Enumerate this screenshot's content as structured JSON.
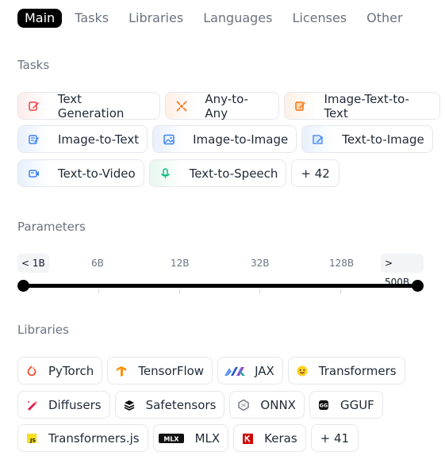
{
  "tabs": [
    "Main",
    "Tasks",
    "Libraries",
    "Languages",
    "Licenses",
    "Other"
  ],
  "tasks": {
    "title": "Tasks",
    "items": [
      {
        "label": "Text Generation",
        "icon": "text-generation-icon",
        "color": "#ef4444"
      },
      {
        "label": "Any-to-Any",
        "icon": "any-to-any-icon",
        "color": "#f97316"
      },
      {
        "label": "Image-Text-to-Text",
        "icon": "image-text-to-text-icon",
        "color": "#f97316"
      },
      {
        "label": "Image-to-Text",
        "icon": "image-to-text-icon",
        "color": "#3b82f6"
      },
      {
        "label": "Image-to-Image",
        "icon": "image-to-image-icon",
        "color": "#3b82f6"
      },
      {
        "label": "Text-to-Image",
        "icon": "text-to-image-icon",
        "color": "#3b82f6"
      },
      {
        "label": "Text-to-Video",
        "icon": "text-to-video-icon",
        "color": "#3b82f6"
      },
      {
        "label": "Text-to-Speech",
        "icon": "text-to-speech-icon",
        "color": "#10b981"
      }
    ],
    "more": "+ 42"
  },
  "parameters": {
    "title": "Parameters",
    "labels": [
      "< 1B",
      "6B",
      "12B",
      "32B",
      "128B",
      "> 500B"
    ],
    "range": [
      "< 1B",
      "> 500B"
    ]
  },
  "libraries": {
    "title": "Libraries",
    "items": [
      {
        "label": "PyTorch",
        "icon": "pytorch-icon"
      },
      {
        "label": "TensorFlow",
        "icon": "tensorflow-icon"
      },
      {
        "label": "JAX",
        "icon": "jax-icon"
      },
      {
        "label": "Transformers",
        "icon": "hugging-face-icon"
      },
      {
        "label": "Diffusers",
        "icon": "diffusers-icon"
      },
      {
        "label": "Safetensors",
        "icon": "safetensors-icon"
      },
      {
        "label": "ONNX",
        "icon": "onnx-icon"
      },
      {
        "label": "GGUF",
        "icon": "gguf-icon"
      },
      {
        "label": "Transformers.js",
        "icon": "js-icon"
      },
      {
        "label": "MLX",
        "icon": "mlx-icon"
      },
      {
        "label": "Keras",
        "icon": "keras-icon"
      }
    ],
    "more": "+ 41"
  }
}
